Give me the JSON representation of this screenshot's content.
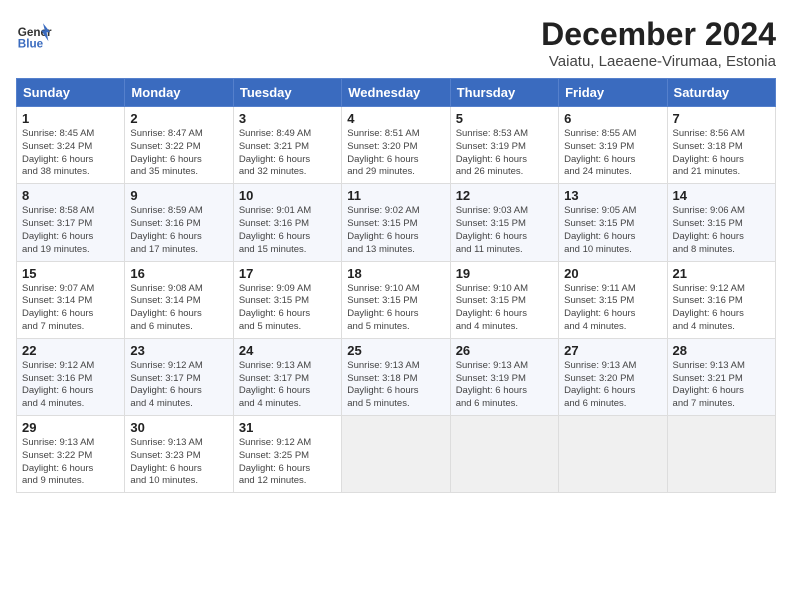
{
  "header": {
    "logo_line1": "General",
    "logo_line2": "Blue",
    "title": "December 2024",
    "subtitle": "Vaiatu, Laeaene-Virumaa, Estonia"
  },
  "columns": [
    "Sunday",
    "Monday",
    "Tuesday",
    "Wednesday",
    "Thursday",
    "Friday",
    "Saturday"
  ],
  "weeks": [
    [
      {
        "day": "1",
        "lines": [
          "Sunrise: 8:45 AM",
          "Sunset: 3:24 PM",
          "Daylight: 6 hours",
          "and 38 minutes."
        ]
      },
      {
        "day": "2",
        "lines": [
          "Sunrise: 8:47 AM",
          "Sunset: 3:22 PM",
          "Daylight: 6 hours",
          "and 35 minutes."
        ]
      },
      {
        "day": "3",
        "lines": [
          "Sunrise: 8:49 AM",
          "Sunset: 3:21 PM",
          "Daylight: 6 hours",
          "and 32 minutes."
        ]
      },
      {
        "day": "4",
        "lines": [
          "Sunrise: 8:51 AM",
          "Sunset: 3:20 PM",
          "Daylight: 6 hours",
          "and 29 minutes."
        ]
      },
      {
        "day": "5",
        "lines": [
          "Sunrise: 8:53 AM",
          "Sunset: 3:19 PM",
          "Daylight: 6 hours",
          "and 26 minutes."
        ]
      },
      {
        "day": "6",
        "lines": [
          "Sunrise: 8:55 AM",
          "Sunset: 3:19 PM",
          "Daylight: 6 hours",
          "and 24 minutes."
        ]
      },
      {
        "day": "7",
        "lines": [
          "Sunrise: 8:56 AM",
          "Sunset: 3:18 PM",
          "Daylight: 6 hours",
          "and 21 minutes."
        ]
      }
    ],
    [
      {
        "day": "8",
        "lines": [
          "Sunrise: 8:58 AM",
          "Sunset: 3:17 PM",
          "Daylight: 6 hours",
          "and 19 minutes."
        ]
      },
      {
        "day": "9",
        "lines": [
          "Sunrise: 8:59 AM",
          "Sunset: 3:16 PM",
          "Daylight: 6 hours",
          "and 17 minutes."
        ]
      },
      {
        "day": "10",
        "lines": [
          "Sunrise: 9:01 AM",
          "Sunset: 3:16 PM",
          "Daylight: 6 hours",
          "and 15 minutes."
        ]
      },
      {
        "day": "11",
        "lines": [
          "Sunrise: 9:02 AM",
          "Sunset: 3:15 PM",
          "Daylight: 6 hours",
          "and 13 minutes."
        ]
      },
      {
        "day": "12",
        "lines": [
          "Sunrise: 9:03 AM",
          "Sunset: 3:15 PM",
          "Daylight: 6 hours",
          "and 11 minutes."
        ]
      },
      {
        "day": "13",
        "lines": [
          "Sunrise: 9:05 AM",
          "Sunset: 3:15 PM",
          "Daylight: 6 hours",
          "and 10 minutes."
        ]
      },
      {
        "day": "14",
        "lines": [
          "Sunrise: 9:06 AM",
          "Sunset: 3:15 PM",
          "Daylight: 6 hours",
          "and 8 minutes."
        ]
      }
    ],
    [
      {
        "day": "15",
        "lines": [
          "Sunrise: 9:07 AM",
          "Sunset: 3:14 PM",
          "Daylight: 6 hours",
          "and 7 minutes."
        ]
      },
      {
        "day": "16",
        "lines": [
          "Sunrise: 9:08 AM",
          "Sunset: 3:14 PM",
          "Daylight: 6 hours",
          "and 6 minutes."
        ]
      },
      {
        "day": "17",
        "lines": [
          "Sunrise: 9:09 AM",
          "Sunset: 3:15 PM",
          "Daylight: 6 hours",
          "and 5 minutes."
        ]
      },
      {
        "day": "18",
        "lines": [
          "Sunrise: 9:10 AM",
          "Sunset: 3:15 PM",
          "Daylight: 6 hours",
          "and 5 minutes."
        ]
      },
      {
        "day": "19",
        "lines": [
          "Sunrise: 9:10 AM",
          "Sunset: 3:15 PM",
          "Daylight: 6 hours",
          "and 4 minutes."
        ]
      },
      {
        "day": "20",
        "lines": [
          "Sunrise: 9:11 AM",
          "Sunset: 3:15 PM",
          "Daylight: 6 hours",
          "and 4 minutes."
        ]
      },
      {
        "day": "21",
        "lines": [
          "Sunrise: 9:12 AM",
          "Sunset: 3:16 PM",
          "Daylight: 6 hours",
          "and 4 minutes."
        ]
      }
    ],
    [
      {
        "day": "22",
        "lines": [
          "Sunrise: 9:12 AM",
          "Sunset: 3:16 PM",
          "Daylight: 6 hours",
          "and 4 minutes."
        ]
      },
      {
        "day": "23",
        "lines": [
          "Sunrise: 9:12 AM",
          "Sunset: 3:17 PM",
          "Daylight: 6 hours",
          "and 4 minutes."
        ]
      },
      {
        "day": "24",
        "lines": [
          "Sunrise: 9:13 AM",
          "Sunset: 3:17 PM",
          "Daylight: 6 hours",
          "and 4 minutes."
        ]
      },
      {
        "day": "25",
        "lines": [
          "Sunrise: 9:13 AM",
          "Sunset: 3:18 PM",
          "Daylight: 6 hours",
          "and 5 minutes."
        ]
      },
      {
        "day": "26",
        "lines": [
          "Sunrise: 9:13 AM",
          "Sunset: 3:19 PM",
          "Daylight: 6 hours",
          "and 6 minutes."
        ]
      },
      {
        "day": "27",
        "lines": [
          "Sunrise: 9:13 AM",
          "Sunset: 3:20 PM",
          "Daylight: 6 hours",
          "and 6 minutes."
        ]
      },
      {
        "day": "28",
        "lines": [
          "Sunrise: 9:13 AM",
          "Sunset: 3:21 PM",
          "Daylight: 6 hours",
          "and 7 minutes."
        ]
      }
    ],
    [
      {
        "day": "29",
        "lines": [
          "Sunrise: 9:13 AM",
          "Sunset: 3:22 PM",
          "Daylight: 6 hours",
          "and 9 minutes."
        ]
      },
      {
        "day": "30",
        "lines": [
          "Sunrise: 9:13 AM",
          "Sunset: 3:23 PM",
          "Daylight: 6 hours",
          "and 10 minutes."
        ]
      },
      {
        "day": "31",
        "lines": [
          "Sunrise: 9:12 AM",
          "Sunset: 3:25 PM",
          "Daylight: 6 hours",
          "and 12 minutes."
        ]
      },
      null,
      null,
      null,
      null
    ]
  ]
}
